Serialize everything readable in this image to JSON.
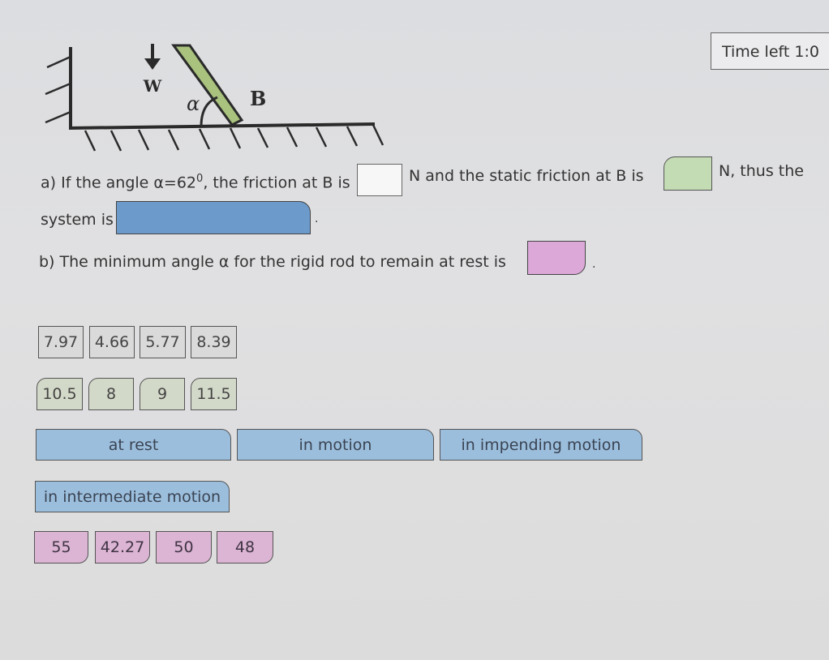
{
  "timer": {
    "label": "Time left 1:0"
  },
  "diagram": {
    "weight_label": "W",
    "angle_label": "α",
    "point_label": "B",
    "rod_color": "#a9c27e"
  },
  "question_a": {
    "line1_part1": "a) If the angle α=62",
    "superscript": "0",
    "line1_part2": ", the friction at B is",
    "line1_part3": "N and the static friction at B is",
    "line1_part4": "N, thus the",
    "line2_part1": "system is",
    "line2_end": "."
  },
  "question_b": {
    "text": "b) The minimum angle α for the rigid rod to remain at rest is",
    "end": "."
  },
  "answer_banks": {
    "friction_options": [
      "7.97",
      "4.66",
      "5.77",
      "8.39"
    ],
    "static_friction_options": [
      "10.5",
      "8",
      "9",
      "11.5"
    ],
    "state_options": [
      "at rest",
      "in motion",
      "in impending motion",
      "in intermediate motion"
    ],
    "angle_options": [
      "55",
      "42.27",
      "50",
      "48"
    ]
  },
  "colors": {
    "friction_drop": "#f7f7f7",
    "static_friction_drop": "#c4dcb4",
    "state_drop": "#6b9acb",
    "angle_drop": "#dba8d8"
  }
}
